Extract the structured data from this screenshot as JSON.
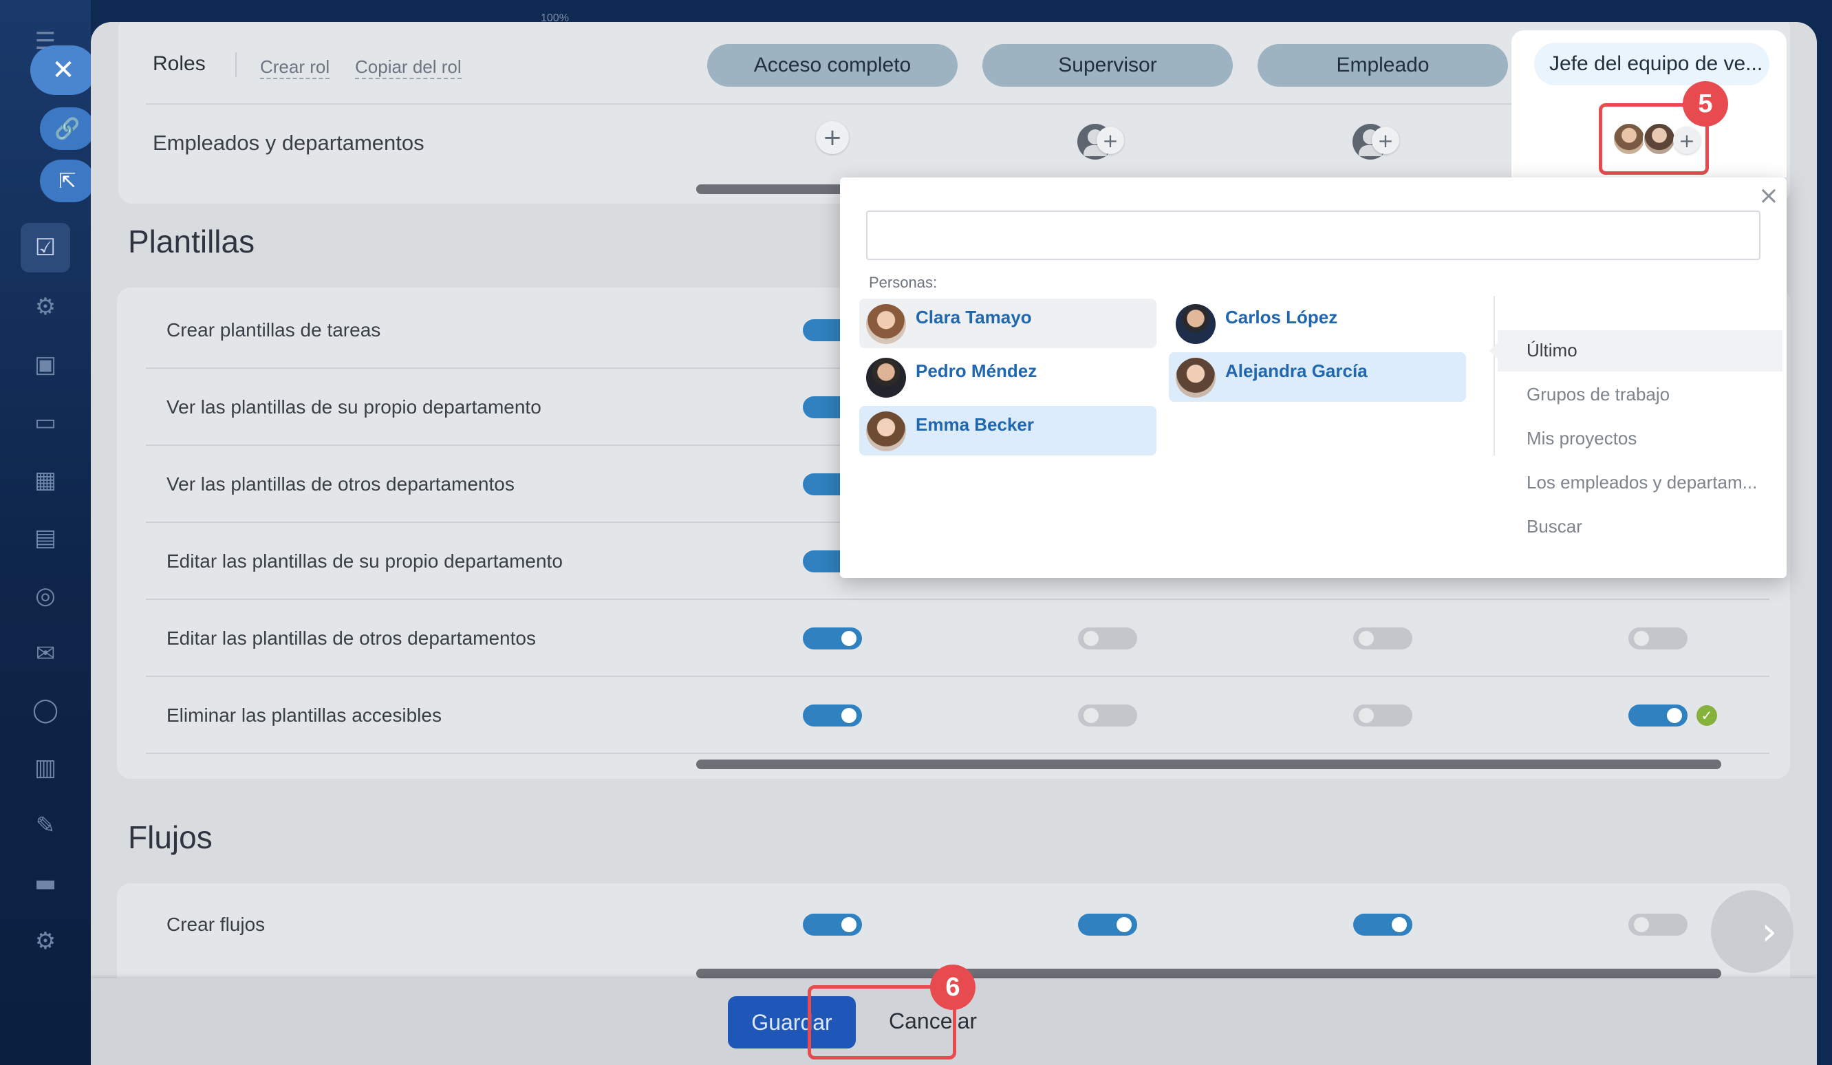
{
  "zoom_label": "100%",
  "sidebar": {
    "icons": [
      "menu-icon",
      "link-icon",
      "external-link-icon",
      "tasks-check-icon",
      "robot-icon",
      "clipboard-icon",
      "card-icon",
      "calendar-icon",
      "building-icon",
      "target-icon",
      "mail-icon",
      "circle-icon",
      "library-icon",
      "pen-icon",
      "wallet-icon",
      "gear-icon"
    ]
  },
  "roles_header": {
    "title": "Roles",
    "create_role": "Crear rol",
    "copy_role": "Copiar del rol",
    "roles": [
      "Acceso completo",
      "Supervisor",
      "Empleado",
      "Jefe del equipo de ve..."
    ]
  },
  "employees_row": {
    "label": "Empleados y departamentos"
  },
  "templates_section": {
    "title": "Plantillas",
    "rows": [
      {
        "label": "Crear plantillas de tareas",
        "toggles": [
          "on"
        ]
      },
      {
        "label": "Ver las plantillas de su propio departamento",
        "toggles": [
          "on"
        ]
      },
      {
        "label": "Ver las plantillas de otros departamentos",
        "toggles": [
          "on"
        ]
      },
      {
        "label": "Editar las plantillas de su propio departamento",
        "toggles": [
          "on"
        ]
      },
      {
        "label": "Editar las plantillas de otros departamentos",
        "toggles": [
          "on",
          "off",
          "off",
          "off"
        ]
      },
      {
        "label": "Eliminar las plantillas accesibles",
        "toggles": [
          "on",
          "off",
          "off",
          "on"
        ]
      }
    ]
  },
  "flows_section": {
    "title": "Flujos",
    "rows": [
      {
        "label": "Crear flujos",
        "toggles": [
          "on",
          "on",
          "on",
          "off"
        ]
      }
    ]
  },
  "popup": {
    "search_value": "",
    "section_label": "Personas:",
    "people": [
      {
        "name": "Clara Tamayo",
        "state": "hover"
      },
      {
        "name": "Carlos López",
        "state": "none"
      },
      {
        "name": "Pedro Méndez",
        "state": "none"
      },
      {
        "name": "Alejandra García",
        "state": "selected"
      },
      {
        "name": "Emma Becker",
        "state": "selected"
      }
    ],
    "menu": [
      "Último",
      "Grupos de trabajo",
      "Mis proyectos",
      "Los empleados y departam...",
      "Buscar"
    ],
    "active_menu": "Último"
  },
  "callouts": {
    "step5": "5",
    "step6": "6"
  },
  "footer": {
    "save_label": "Guardar",
    "cancel_label": "Cancelar"
  },
  "colors": {
    "toggle_on": "#2f81bf",
    "callout": "#e84b4f",
    "save_button": "#1f57b8",
    "link_blue": "#2067b0"
  }
}
